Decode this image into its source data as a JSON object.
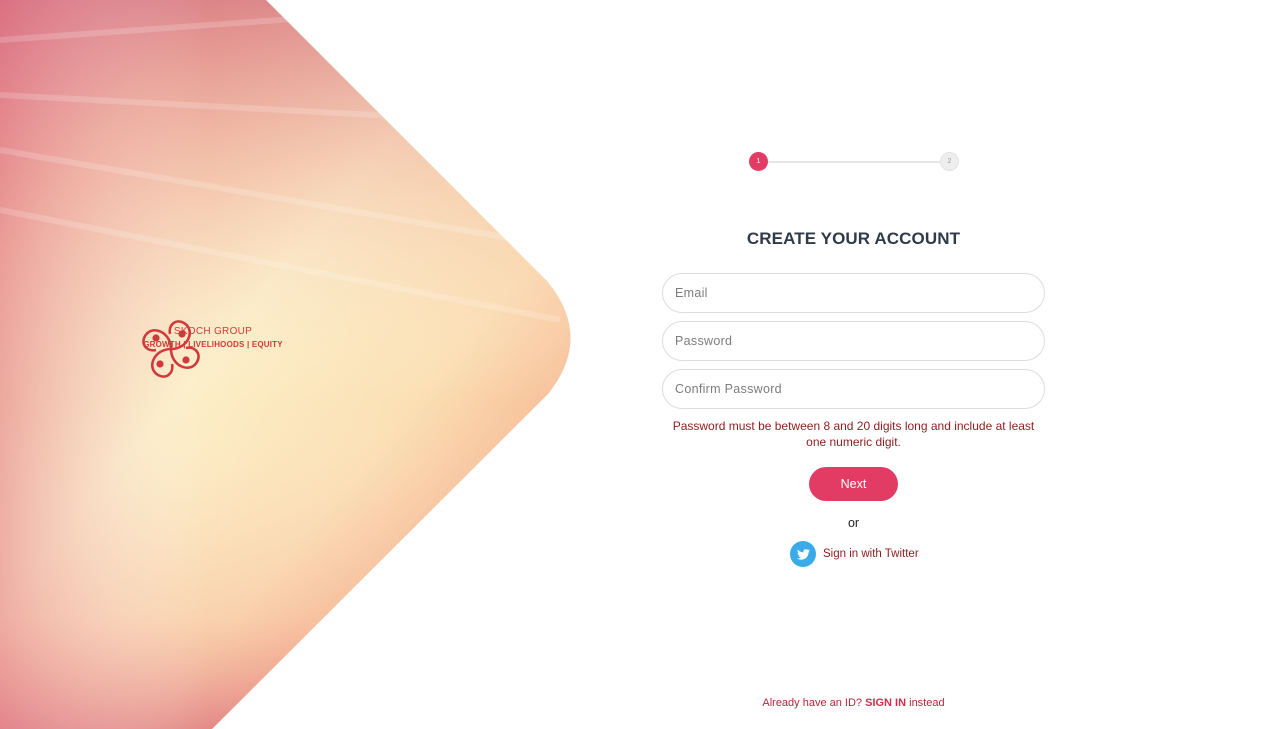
{
  "brand": {
    "name": "SKOCH GROUP",
    "tagline": "GROWTH | LIVELIHOODS | EQUITY"
  },
  "stepper": {
    "steps": [
      "1",
      "2"
    ],
    "current": 1
  },
  "form": {
    "title": "CREATE YOUR ACCOUNT",
    "email_placeholder": "Email",
    "password_placeholder": "Password",
    "confirm_placeholder": "Confirm Password",
    "hint": "Password must be between 8 and 20 digits long and include at least one numeric digit.",
    "next_label": "Next",
    "or_label": "or",
    "twitter_label": "Sign in with Twitter",
    "twitter_icon": "twitter-bird-icon"
  },
  "footer": {
    "prefix": "Already have an ID?",
    "signin_label": "SIGN IN",
    "suffix": "instead"
  },
  "colors": {
    "accent": "#e23c64",
    "brand_red": "#cf3a3a",
    "twitter_blue": "#3aaae8",
    "hint_text": "#8b1e1e"
  }
}
